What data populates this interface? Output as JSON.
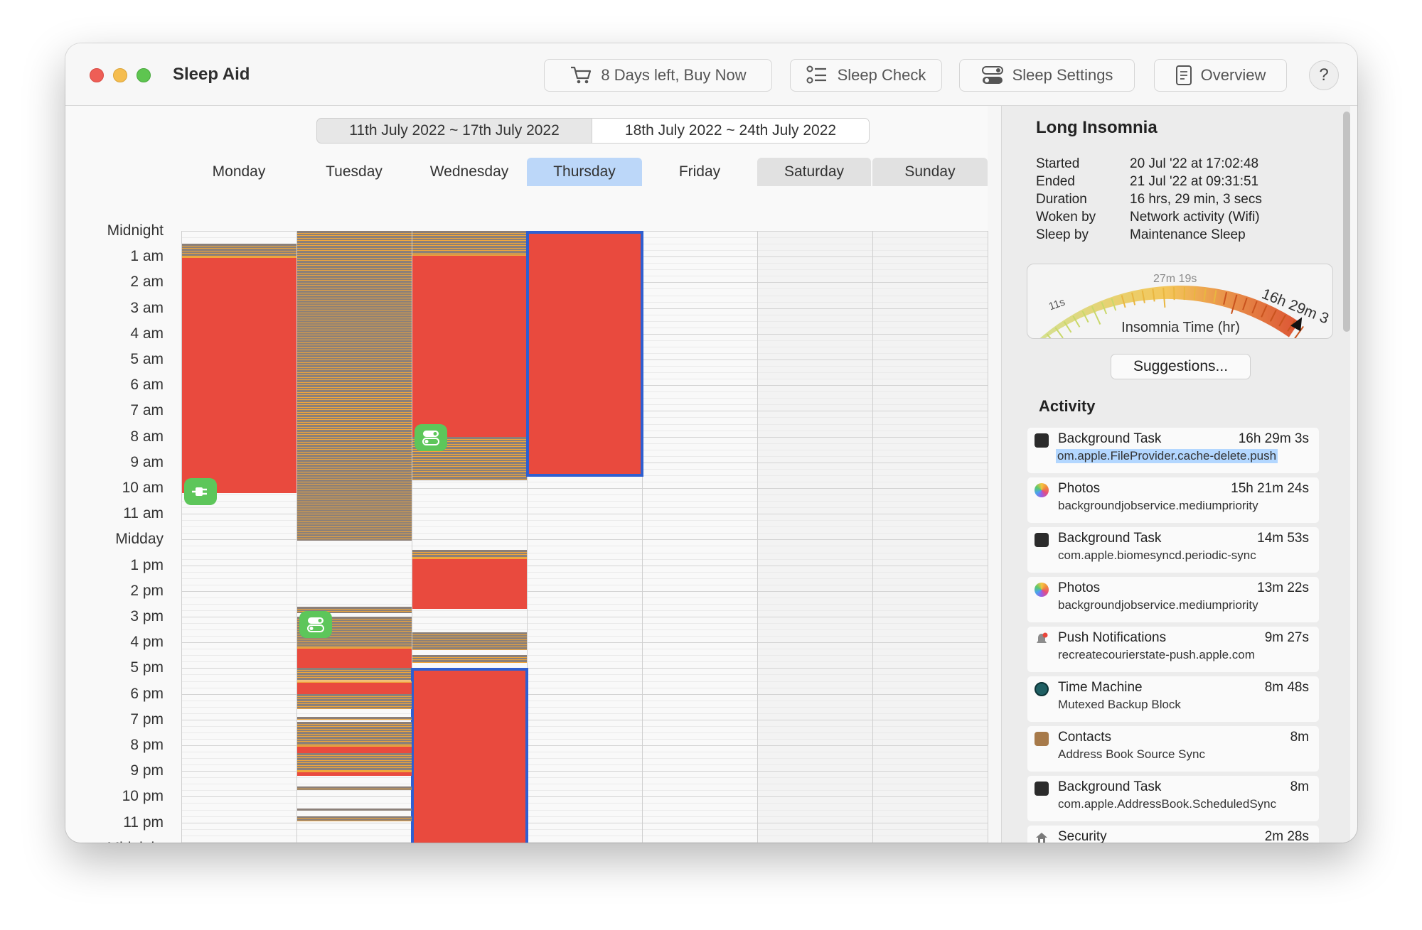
{
  "app_title": "Sleep Aid",
  "toolbar": {
    "buy_label": "8 Days left, Buy Now",
    "check_label": "Sleep Check",
    "settings_label": "Sleep Settings",
    "overview_label": "Overview",
    "help_label": "?"
  },
  "weeks": [
    "11th July 2022 ~ 17th July 2022",
    "18th July 2022 ~ 24th July 2022"
  ],
  "days": [
    "Monday",
    "Tuesday",
    "Wednesday",
    "Thursday",
    "Friday",
    "Saturday",
    "Sunday"
  ],
  "hours": [
    "Midnight",
    "1 am",
    "2 am",
    "3 am",
    "4 am",
    "5 am",
    "6 am",
    "7 am",
    "8 am",
    "9 am",
    "10 am",
    "11 am",
    "Midday",
    "1 pm",
    "2 pm",
    "3 pm",
    "4 pm",
    "5 pm",
    "6 pm",
    "7 pm",
    "8 pm",
    "9 pm",
    "10 pm",
    "11 pm",
    "Midnight"
  ],
  "colors": {
    "sleep": "#e94a3e",
    "dark_wake": "#8b8079",
    "maint": "#f0a63b",
    "selected": "#2f5fd0",
    "badge": "#5dc65a",
    "today": "#bcd7f9"
  },
  "sleep_blocks": [
    {
      "day": 0,
      "start": 0.5,
      "end": 1.0,
      "kind": "mix"
    },
    {
      "day": 0,
      "start": 1.0,
      "end": 10.2,
      "kind": "sleep"
    },
    {
      "day": 1,
      "start": 0.0,
      "end": 12.05,
      "kind": "mix"
    },
    {
      "day": 2,
      "start": 0.0,
      "end": 0.9,
      "kind": "mix"
    },
    {
      "day": 2,
      "start": 0.9,
      "end": 8.0,
      "kind": "sleep"
    },
    {
      "day": 2,
      "start": 8.0,
      "end": 9.7,
      "kind": "mix"
    },
    {
      "day": 3,
      "start": 0.0,
      "end": 9.55,
      "kind": "sleep",
      "selected": true
    },
    {
      "day": 2,
      "start": 12.4,
      "end": 12.7,
      "kind": "mix"
    },
    {
      "day": 2,
      "start": 12.7,
      "end": 14.7,
      "kind": "sleep"
    },
    {
      "day": 1,
      "start": 14.6,
      "end": 14.85,
      "kind": "mix"
    },
    {
      "day": 1,
      "start": 15.0,
      "end": 16.2,
      "kind": "mix"
    },
    {
      "day": 2,
      "start": 15.6,
      "end": 16.3,
      "kind": "mix"
    },
    {
      "day": 1,
      "start": 16.2,
      "end": 17.0,
      "kind": "sleep"
    },
    {
      "day": 2,
      "start": 16.5,
      "end": 16.8,
      "kind": "mix"
    },
    {
      "day": 1,
      "start": 17.0,
      "end": 17.5,
      "kind": "mix"
    },
    {
      "day": 2,
      "start": 17.0,
      "end": 24.0,
      "kind": "sleep",
      "selected": true
    },
    {
      "day": 1,
      "start": 17.5,
      "end": 18.0,
      "kind": "sleep"
    },
    {
      "day": 1,
      "start": 18.0,
      "end": 18.6,
      "kind": "mix"
    },
    {
      "day": 1,
      "start": 18.9,
      "end": 19.0,
      "kind": "mix"
    },
    {
      "day": 1,
      "start": 19.1,
      "end": 20.0,
      "kind": "mix"
    },
    {
      "day": 1,
      "start": 20.0,
      "end": 20.3,
      "kind": "sleep"
    },
    {
      "day": 1,
      "start": 20.3,
      "end": 21.0,
      "kind": "mix"
    },
    {
      "day": 1,
      "start": 21.0,
      "end": 21.2,
      "kind": "sleep"
    },
    {
      "day": 1,
      "start": 21.6,
      "end": 21.75,
      "kind": "mix"
    },
    {
      "day": 1,
      "start": 22.45,
      "end": 22.55,
      "kind": "mix"
    },
    {
      "day": 1,
      "start": 22.75,
      "end": 22.95,
      "kind": "mix"
    }
  ],
  "badges": [
    {
      "day": 0,
      "hour": 10.15,
      "icon": "plug"
    },
    {
      "day": 2,
      "hour": 8.05,
      "icon": "toggle"
    },
    {
      "day": 1,
      "hour": 15.3,
      "icon": "toggle"
    }
  ],
  "detail": {
    "title": "Long Insomnia",
    "rows": [
      {
        "k": "Started",
        "v": "20 Jul '22 at 17:02:48"
      },
      {
        "k": "Ended",
        "v": "21 Jul '22 at 09:31:51"
      },
      {
        "k": "Duration",
        "v": "16 hrs, 29 min, 3 secs"
      },
      {
        "k": "Woken by",
        "v": "Network activity (Wifi)"
      },
      {
        "k": "Sleep by",
        "v": "Maintenance Sleep"
      }
    ]
  },
  "gauge": {
    "label": "Insomnia Time (hr)",
    "start": "11s",
    "mid": "27m 19s",
    "end": "16h 29m 3",
    "value_fraction": 0.98
  },
  "suggestions_label": "Suggestions...",
  "activity_title": "Activity",
  "activity": [
    {
      "name": "Background Task",
      "duration": "16h 29m 3s",
      "sub": "om.apple.FileProvider.cache-delete.push",
      "icon": "terminal-icon",
      "color": "#2b2b2b"
    },
    {
      "name": "Photos",
      "duration": "15h 21m 24s",
      "sub": "backgroundjobservice.mediumpriority",
      "icon": "photos-icon",
      "color": "#e9a13b"
    },
    {
      "name": "Background Task",
      "duration": "14m 53s",
      "sub": "com.apple.biomesyncd.periodic-sync",
      "icon": "terminal-icon",
      "color": "#2b2b2b"
    },
    {
      "name": "Photos",
      "duration": "13m 22s",
      "sub": "backgroundjobservice.mediumpriority",
      "icon": "photos-icon",
      "color": "#e9a13b"
    },
    {
      "name": "Push Notifications",
      "duration": "9m 27s",
      "sub": "recreatecourierstate-push.apple.com",
      "icon": "bell-icon",
      "color": "#888888"
    },
    {
      "name": "Time Machine",
      "duration": "8m 48s",
      "sub": "Mutexed Backup Block",
      "icon": "time-machine-icon",
      "color": "#1f5f63"
    },
    {
      "name": "Contacts",
      "duration": "8m",
      "sub": "Address Book Source Sync",
      "icon": "contacts-icon",
      "color": "#a77a4a"
    },
    {
      "name": "Background Task",
      "duration": "8m",
      "sub": "com.apple.AddressBook.ScheduledSync",
      "icon": "terminal-icon",
      "color": "#2b2b2b"
    },
    {
      "name": "Security",
      "duration": "2m 28s",
      "sub": "",
      "icon": "security-icon",
      "color": "#7a7a7a"
    }
  ]
}
